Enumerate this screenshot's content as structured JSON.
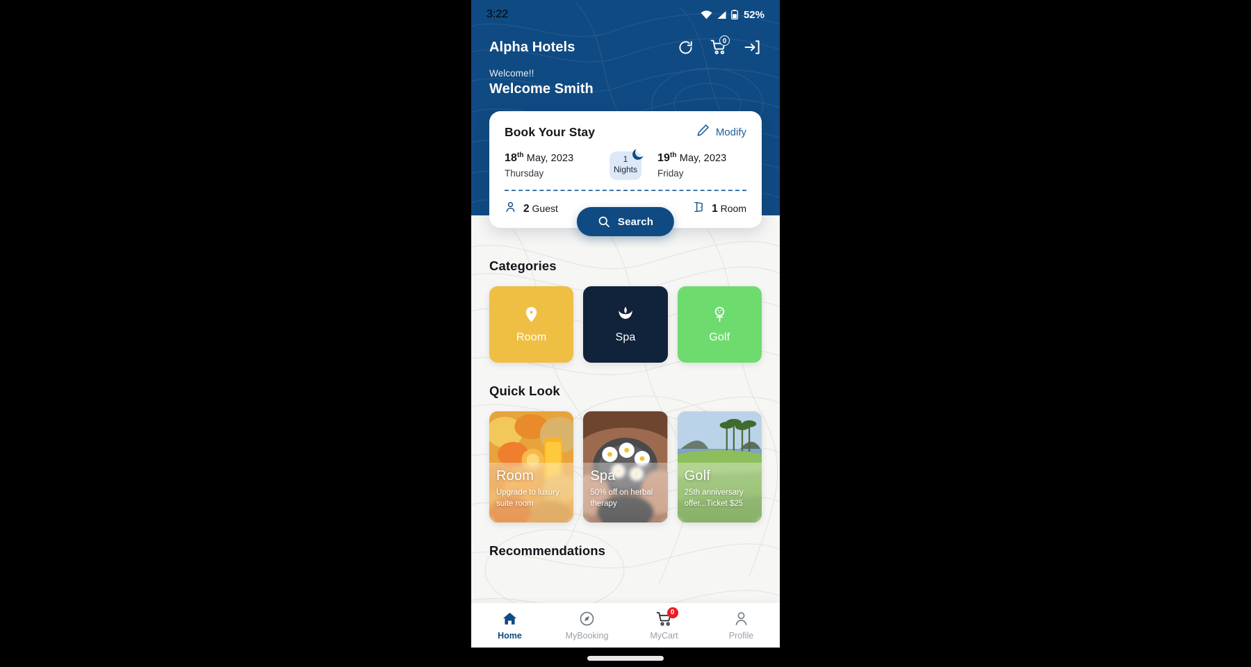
{
  "status_bar": {
    "time": "3:22",
    "battery_text": "52%",
    "icons": [
      "wifi-icon",
      "signal-icon",
      "battery-icon"
    ]
  },
  "app_bar": {
    "brand": "Alpha Hotels",
    "actions": [
      {
        "name": "refresh-icon",
        "label": ""
      },
      {
        "name": "cart-icon",
        "label": "",
        "badge": "0"
      },
      {
        "name": "login-icon",
        "label": ""
      }
    ],
    "cart_badge": "0"
  },
  "welcome": {
    "greeting": "Welcome!!",
    "user": "Welcome Smith"
  },
  "booking_card": {
    "title": "Book Your Stay",
    "modify_label": "Modify",
    "modify_icon": "pencil-icon",
    "check_in": {
      "day_number": "18",
      "ordinal": "th",
      "month_year": "May, 2023",
      "weekday": "Thursday"
    },
    "check_out": {
      "day_number": "19",
      "ordinal": "th",
      "month_year": "May, 2023",
      "weekday": "Friday"
    },
    "nights": {
      "count": "1",
      "label": "Nights",
      "icon": "moon-icon"
    },
    "guests": {
      "count": "2",
      "label": "Guest",
      "icon": "person-icon"
    },
    "rooms": {
      "count": "1",
      "label": "Room",
      "icon": "door-icon"
    },
    "search_label": "Search",
    "search_icon": "search-icon"
  },
  "categories": {
    "title": "Categories",
    "items": [
      {
        "label": "Room",
        "icon": "location-pin-icon",
        "color": "#EFBF44"
      },
      {
        "label": "Spa",
        "icon": "lotus-icon",
        "color": "#11233A"
      },
      {
        "label": "Golf",
        "icon": "golf-tee-icon",
        "color": "#6EDB6E"
      }
    ]
  },
  "quick_look": {
    "title": "Quick Look",
    "items": [
      {
        "title": "Room",
        "subtitle": "Upgrade to luxury suite room",
        "image": "fruit-juice-breakfast-photo"
      },
      {
        "title": "Spa",
        "subtitle": "50% off on herbal therapy",
        "image": "spa-flowers-foot-bath-photo"
      },
      {
        "title": "Golf",
        "subtitle": "25th anniversary offer...Ticket $25",
        "image": "golf-course-palm-trees-photo"
      }
    ]
  },
  "recommendations": {
    "title": "Recommendations"
  },
  "bottom_nav": {
    "items": [
      {
        "label": "Home",
        "icon": "home-icon",
        "active": true
      },
      {
        "label": "MyBooking",
        "icon": "compass-icon",
        "active": false
      },
      {
        "label": "MyCart",
        "icon": "cart-icon",
        "active": false,
        "badge": "0"
      },
      {
        "label": "Profile",
        "icon": "person-icon",
        "active": false
      }
    ]
  },
  "colors": {
    "header_blue": "#104A82",
    "accent_blue": "#1B5C9E",
    "badge_red": "#EB1C24",
    "page_bg": "#F6F6F4"
  }
}
